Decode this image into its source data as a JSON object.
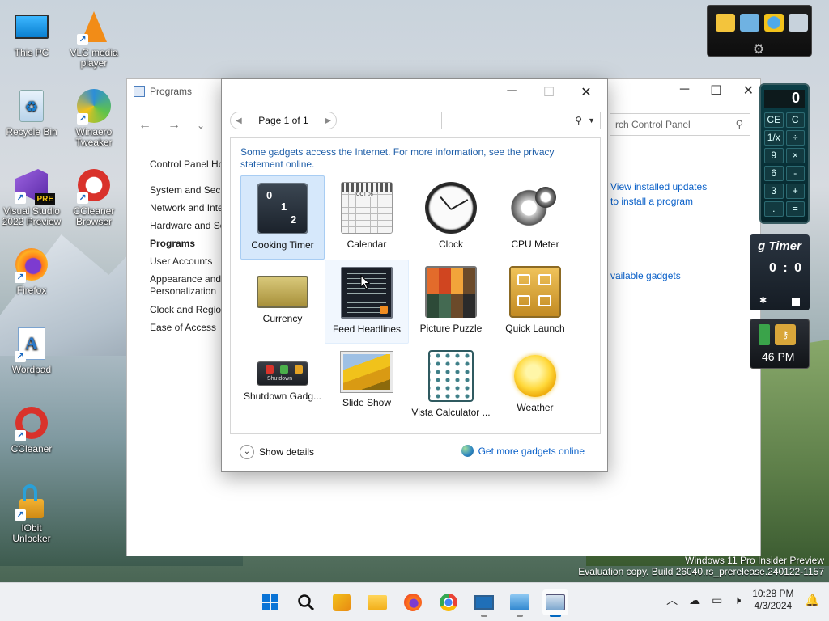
{
  "desktop": {
    "icons": [
      {
        "label": "This PC"
      },
      {
        "label": "VLC media player"
      },
      {
        "label": "Recycle Bin"
      },
      {
        "label": "Winaero Tweaker"
      },
      {
        "label": "Visual Studio 2022 Preview"
      },
      {
        "label": "CCleaner Browser"
      },
      {
        "label": "Firefox"
      },
      {
        "label": "Wordpad"
      },
      {
        "label": "CCleaner"
      },
      {
        "label": "IObit Unlocker"
      }
    ],
    "vs_badge": "PRE"
  },
  "control_panel": {
    "title": "Programs",
    "search_placeholder": "rch Control Panel",
    "sidebar": {
      "home": "Control Panel Ho",
      "items": [
        "System and Secu",
        "Network and Inte",
        "Hardware and So",
        "Programs",
        "User Accounts",
        "Appearance and Personalization",
        "Clock and Region",
        "Ease of Access"
      ]
    },
    "links": {
      "view_updates": "View installed updates",
      "install_program": "to install a program",
      "available_gadgets": "vailable gadgets"
    }
  },
  "gadgets_dialog": {
    "pager": "Page 1 of 1",
    "search_value": "",
    "notice": "Some gadgets access the Internet.  For more information, see the privacy statement online.",
    "items": [
      {
        "label": "Cooking Timer",
        "selected": true
      },
      {
        "label": "Calendar"
      },
      {
        "label": "Clock"
      },
      {
        "label": "CPU Meter"
      },
      {
        "label": "Currency"
      },
      {
        "label": "Feed Headlines",
        "hovered": true
      },
      {
        "label": "Picture Puzzle"
      },
      {
        "label": "Quick Launch"
      },
      {
        "label": "Shutdown Gadg..."
      },
      {
        "label": "Slide Show"
      },
      {
        "label": "Vista Calculator ..."
      },
      {
        "label": "Weather"
      }
    ],
    "timer_digits": [
      "0",
      "1",
      "2"
    ],
    "calendar_month": "OCT 06",
    "shutdown_text": "Shutdown",
    "show_details": "Show details",
    "get_more": "Get more gadgets online"
  },
  "side_gadgets": {
    "calc_display": "0",
    "calc_keys": [
      "CE",
      "C",
      "1/x",
      "÷",
      "9",
      "×",
      "6",
      "-",
      "3",
      "+",
      ".",
      "="
    ],
    "timer_title": "g Timer",
    "timer_value": "0 : 0",
    "time_partial": "46 PM"
  },
  "watermark": {
    "line1": "Windows 11 Pro Insider Preview",
    "line2": "Evaluation copy. Build 26040.rs_prerelease.240122-1157"
  },
  "taskbar": {
    "time": "10:28 PM",
    "date": "4/3/2024",
    "colors": {
      "accent": "#0067c0"
    }
  }
}
